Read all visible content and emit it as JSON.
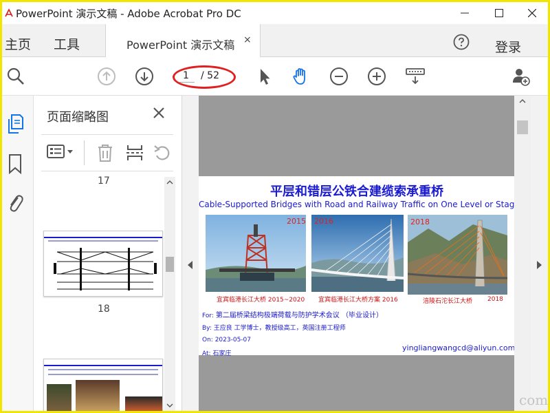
{
  "window": {
    "title": "PowerPoint 演示文稿 - Adobe Acrobat Pro DC"
  },
  "tabs": {
    "home": "主页",
    "tools": "工具",
    "document": "PowerPoint 演示文稿",
    "close_glyph": "×",
    "login": "登录"
  },
  "toolbar": {
    "current_page": "1",
    "total_pages": "/ 52"
  },
  "thumbnails": {
    "title": "页面缩略图",
    "pages": [
      {
        "label": "17"
      },
      {
        "label": "18"
      }
    ]
  },
  "slide": {
    "title": "平层和错层公铁合建缆索承重桥",
    "subtitle": "Cable-Supported Bridges with Road and Railway Traffic on One Level or Stagger Level",
    "photos": [
      {
        "year": "2015",
        "caption": "宜宾临港长江大桥 2015~2020"
      },
      {
        "year": "2016",
        "caption": "宜宾临港长江大桥方案 2016"
      },
      {
        "year": "2018",
        "caption": "涪陵石沱长江大桥",
        "caption_year": "2018"
      }
    ],
    "for_label": "For:",
    "for_value": "第二届桥梁结构极端荷载与防护学术会议 （毕业设计）",
    "by_label": "By:",
    "by_value": "王应良 工学博士，教授级高工，英国注册工程师",
    "on_label": "On:",
    "on_value": "2023-05-07",
    "at_label": "At:",
    "at_value": "石家庄",
    "email": "yingliangwangcd@aliyun.com"
  },
  "watermark": {
    "corner": "com"
  },
  "colors": {
    "accent_blue": "#1473e6",
    "slide_blue": "#1a1ad0",
    "slide_red": "#e02020",
    "frame_yellow": "#f2e600"
  },
  "icons": {
    "toolbar": [
      "search-icon",
      "page-up-icon",
      "page-down-icon",
      "select-arrow-icon",
      "hand-icon",
      "zoom-out-icon",
      "zoom-in-icon",
      "fit-page-icon",
      "add-user-icon"
    ],
    "rail": [
      "pages-icon",
      "bookmark-icon",
      "attachment-icon"
    ]
  }
}
